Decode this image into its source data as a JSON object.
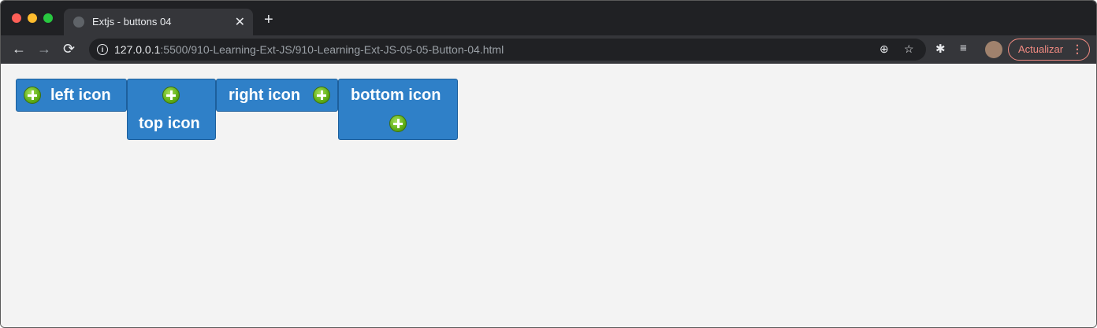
{
  "browser": {
    "tab_title": "Extjs - buttons 04",
    "tab_close": "✕",
    "new_tab": "+",
    "nav": {
      "back": "←",
      "forward": "→",
      "reload": "⟳"
    },
    "url_host": "127.0.0.1",
    "url_path": ":5500/910-Learning-Ext-JS/910-Learning-Ext-JS-05-05-Button-04.html",
    "zoom_icon": "⊕",
    "star_icon": "☆",
    "ext_icon": "✱",
    "media_icon": "≡",
    "update_label": "Actualizar",
    "menu_icon": "⋮"
  },
  "buttons": {
    "left": "left icon",
    "top": "top icon",
    "right": "right icon",
    "bottom": "bottom icon"
  },
  "colors": {
    "button_bg": "#2f80c8",
    "icon_green": "#5fae16"
  }
}
